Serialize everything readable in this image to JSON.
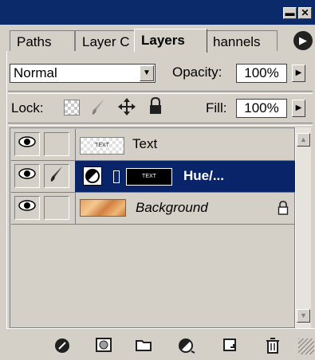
{
  "window": {
    "minimize_glyph": "▬",
    "close_glyph": "✕"
  },
  "tabs": [
    {
      "label": "Paths",
      "active": false
    },
    {
      "label": "Layer C",
      "active": false
    },
    {
      "label": "Layers",
      "active": true
    },
    {
      "label": "hannels",
      "active": false
    }
  ],
  "panel_menu_glyph": "▶",
  "blend": {
    "mode": "Normal",
    "arrow": "▼",
    "opacity_label": "Opacity:",
    "opacity_value": "100%",
    "fill_label": "Fill:",
    "fill_value": "100%",
    "stepper_arrow": "▶"
  },
  "lock": {
    "label": "Lock:",
    "icons": [
      "lock-transparent-icon",
      "lock-image-brush-icon",
      "lock-position-move-icon",
      "lock-all-padlock-icon"
    ]
  },
  "layers": [
    {
      "name": "Text",
      "visible": true,
      "selected": false,
      "thumb_text": "TEXT",
      "italic": false
    },
    {
      "name": "Hue/...",
      "visible": true,
      "selected": true,
      "mask_text": "TEXT",
      "italic": false
    },
    {
      "name": "Background",
      "visible": true,
      "selected": false,
      "italic": true,
      "locked": true
    }
  ],
  "colors": {
    "selection": "#0a246a",
    "panel": "#d4d0c8",
    "title": "#0a2a6a"
  },
  "bottom_icons": [
    "link-layers-icon",
    "add-layer-mask-icon",
    "new-group-folder-icon",
    "adjustment-layer-icon",
    "new-layer-icon",
    "delete-trash-icon"
  ]
}
